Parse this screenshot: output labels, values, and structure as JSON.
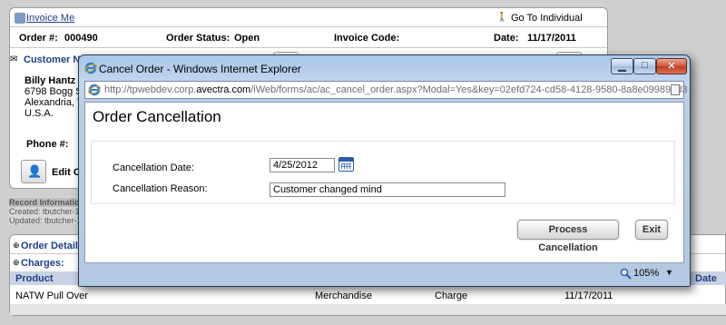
{
  "background": {
    "invoice_me": "Invoice Me",
    "go_to_individual": "Go To Individual",
    "order_no_label": "Order #:",
    "order_no": "000490",
    "order_status_label": "Order Status:",
    "order_status": "Open",
    "invoice_code_label": "Invoice Code:",
    "date_label": "Date:",
    "date": "11/17/2011",
    "customer_name_label": "Customer Na",
    "customer_name": "Billy Hantz",
    "address_line1": "6798 Bogg Str",
    "address_line2": "Alexandria, VA",
    "address_line3": "U.S.A.",
    "phone_label": "Phone #:",
    "edit_label": "Edit O",
    "record_info": "Record Informatio",
    "created": "Created: tbutcher-11",
    "updated": "Updated: tbutcher-11",
    "order_details": "Order Details",
    "charges": "Charges:",
    "product_header": "Product",
    "date_header": "Date",
    "row_product": "NATW Pull Over",
    "row_type": "Merchandise",
    "row_charge": "Charge",
    "row_date": "11/17/2011"
  },
  "window": {
    "title": "Cancel Order - Windows Internet Explorer",
    "url_prefix": "http://tpwebdev.corp.",
    "url_domain": "avectra.com",
    "url_suffix": "/iWeb/forms/ac/ac_cancel_order.aspx?Modal=Yes&key=02efd724-cd58-4128-9580-8a8e099897d3",
    "min_glyph": "▁",
    "max_glyph": "□",
    "close_glyph": "✕"
  },
  "form": {
    "heading": "Order Cancellation",
    "date_label": "Cancellation Date:",
    "date_value": "4/25/2012",
    "reason_label": "Cancellation Reason:",
    "reason_value": "Customer changed mind",
    "process_button": "Process Cancellation",
    "exit_button": "Exit"
  },
  "status": {
    "zoom": "105%",
    "zoom_arrow": "▼"
  },
  "colors": {
    "link_blue": "#1e3f8a",
    "window_frame": "#b3c8e2",
    "close_red": "#c23b1e"
  }
}
